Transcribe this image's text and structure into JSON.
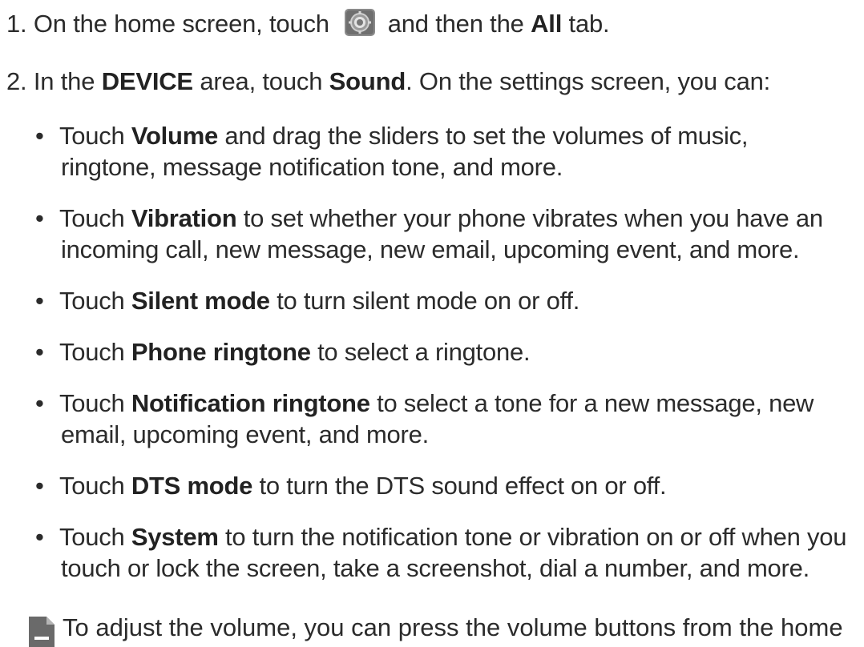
{
  "steps": [
    {
      "num": "1.",
      "parts": {
        "a": "On the home screen, touch",
        "b": "and then the",
        "c": "All",
        "d": "tab."
      },
      "icon": "settings-gear-icon"
    },
    {
      "num": "2.",
      "parts": {
        "a": "In the",
        "b": "DEVICE",
        "c": "area, touch",
        "d": "Sound",
        "e": ". On the settings screen, you can:"
      }
    }
  ],
  "bullet_char": "•",
  "bullets": [
    {
      "pre": "Touch",
      "bold": "Volume",
      "post": "and drag the sliders to set the volumes of music,",
      "line2": "ringtone, message notification tone, and more."
    },
    {
      "pre": "Touch",
      "bold": "Vibration",
      "post": "to set whether your phone vibrates when you have an",
      "line2": "incoming call, new message, new email, upcoming event, and more."
    },
    {
      "pre": "Touch",
      "bold": "Silent mode",
      "post": "to turn silent mode on or off."
    },
    {
      "pre": "Touch",
      "bold": "Phone ringtone",
      "post": "to select a ringtone."
    },
    {
      "pre": "Touch",
      "bold": "Notification ringtone",
      "post": "to select a tone for a new message, new",
      "line2": "email, upcoming event, and more."
    },
    {
      "pre": "Touch",
      "bold": "DTS mode",
      "post": "to turn the DTS sound effect on or off."
    },
    {
      "pre": "Touch",
      "bold": "System",
      "post": "to turn the notification tone or vibration on or off when you",
      "line2": "touch or lock the screen, take a screenshot, dial a number, and more."
    }
  ],
  "note": {
    "icon": "note-document-icon",
    "text": "To adjust the volume, you can press the volume buttons from the home"
  }
}
